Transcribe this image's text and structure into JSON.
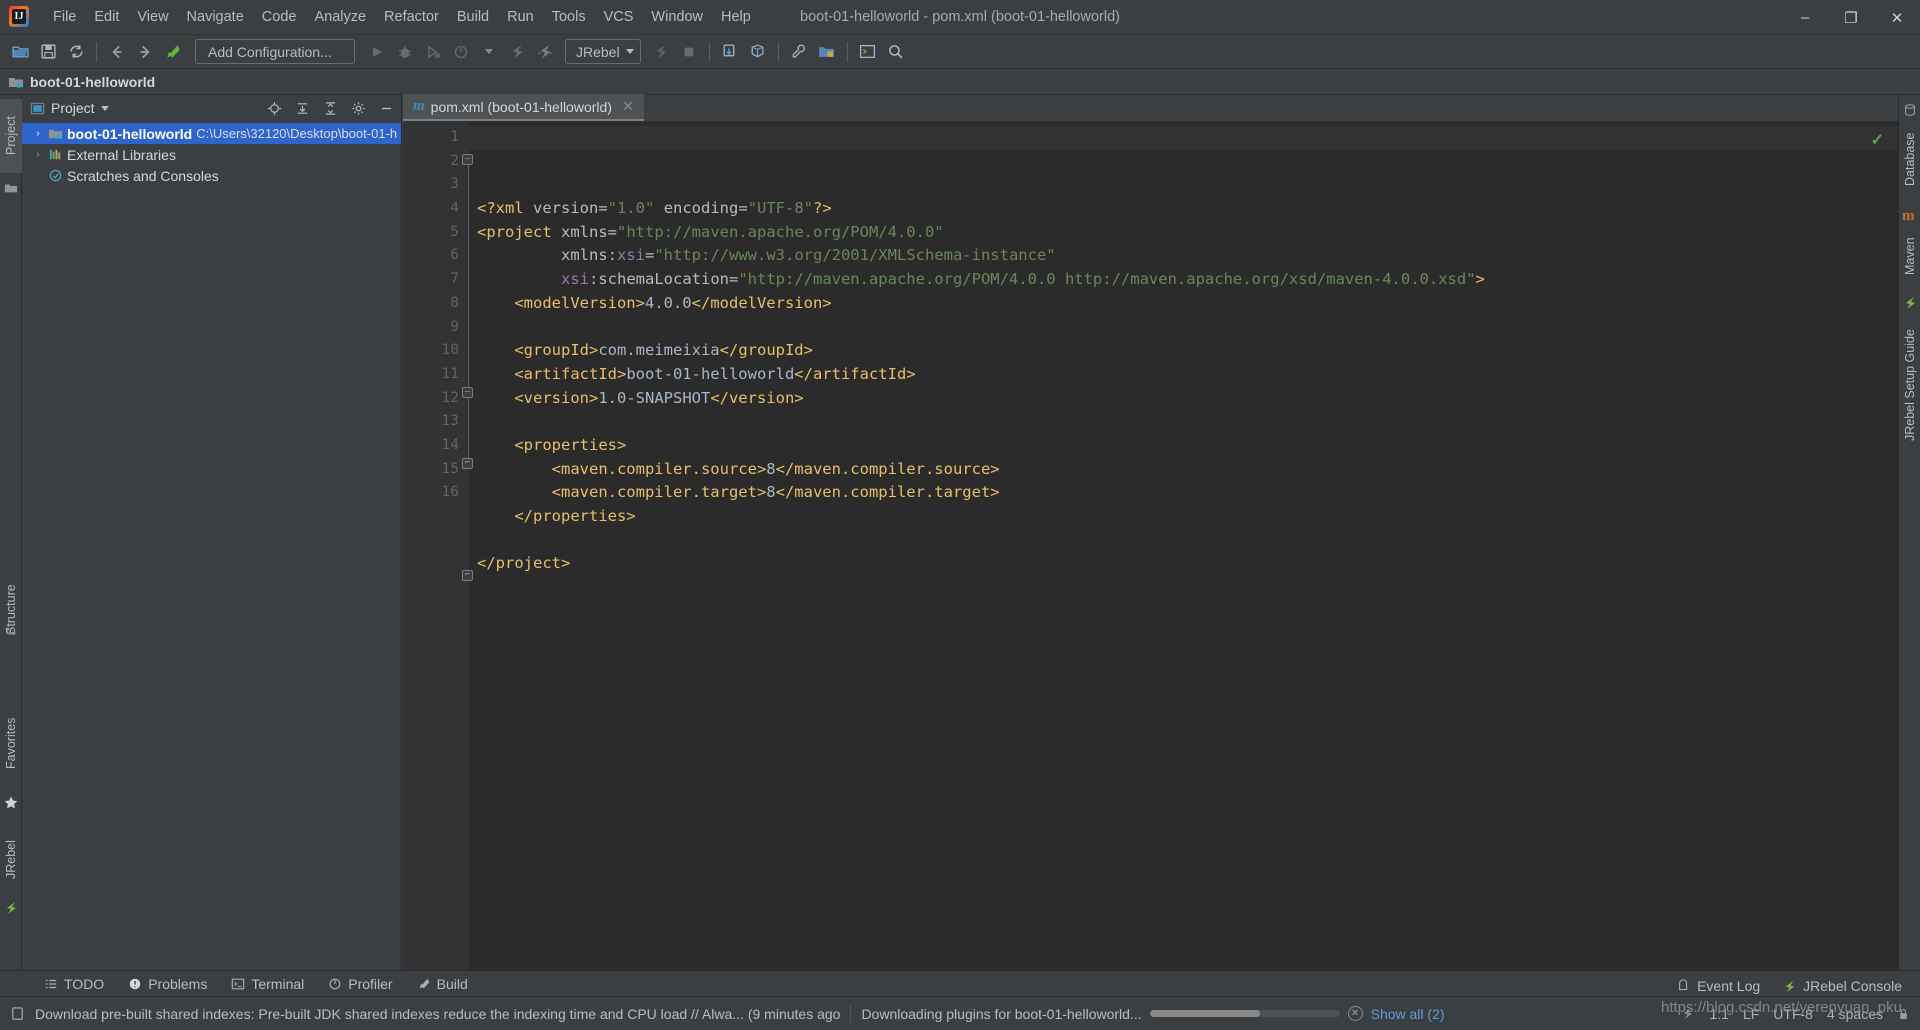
{
  "window": {
    "title": "boot-01-helloworld - pom.xml (boot-01-helloworld)",
    "minimize": "–",
    "maximize": "❐",
    "close": "✕"
  },
  "menubar": {
    "items": [
      {
        "label": "File"
      },
      {
        "label": "Edit"
      },
      {
        "label": "View"
      },
      {
        "label": "Navigate"
      },
      {
        "label": "Code"
      },
      {
        "label": "Analyze"
      },
      {
        "label": "Refactor"
      },
      {
        "label": "Build"
      },
      {
        "label": "Run"
      },
      {
        "label": "Tools"
      },
      {
        "label": "VCS"
      },
      {
        "label": "Window"
      },
      {
        "label": "Help"
      }
    ]
  },
  "toolbar": {
    "add_configuration": "Add Configuration...",
    "jrebel_label": "JRebel",
    "icons": [
      "open-folder-icon",
      "save-icon",
      "sync-icon",
      "back-arrow-icon",
      "forward-arrow-icon",
      "build-hammer-icon",
      "run-icon",
      "debug-icon",
      "run-coverage-icon",
      "profile-icon",
      "jrebel-run-icon",
      "jrebel-debug-icon",
      "stop-icon",
      "stop-square-icon",
      "update-project-icon",
      "commit-icon",
      "settings-wrench-icon",
      "project-structure-icon",
      "terminal-icon",
      "search-everywhere-icon"
    ]
  },
  "breadcrumb": {
    "project_name": "boot-01-helloworld"
  },
  "left_rail": {
    "items": [
      {
        "label": "Project",
        "active": true
      },
      {
        "label": "Structure",
        "active": false
      },
      {
        "label": "Favorites",
        "active": false
      },
      {
        "label": "JRebel",
        "active": false
      }
    ]
  },
  "right_rail": {
    "items": [
      {
        "label": "Database"
      },
      {
        "label": "Maven"
      },
      {
        "label": "JRebel Setup Guide"
      }
    ]
  },
  "project_panel": {
    "title": "Project",
    "header_buttons": [
      "locate-target-icon",
      "expand-all-icon",
      "collapse-all-icon",
      "gear-icon",
      "hide-icon"
    ],
    "tree": [
      {
        "label": "boot-01-helloworld",
        "path": "C:\\Users\\32120\\Desktop\\boot-01-h",
        "icon": "module-folder-icon",
        "arrow": "›",
        "selected": true,
        "bold": true,
        "indent": 0
      },
      {
        "label": "External Libraries",
        "path": "",
        "icon": "libraries-icon",
        "arrow": "›",
        "selected": false,
        "bold": false,
        "indent": 0
      },
      {
        "label": "Scratches and Consoles",
        "path": "",
        "icon": "scratches-icon",
        "arrow": "",
        "selected": false,
        "bold": false,
        "indent": 0
      }
    ]
  },
  "editor": {
    "tab": {
      "icon": "maven-m-icon",
      "label": "pom.xml (boot-01-helloworld)",
      "close": "✕"
    },
    "inspection_status": "✓",
    "line_numbers": [
      1,
      2,
      3,
      4,
      5,
      6,
      7,
      8,
      9,
      10,
      11,
      12,
      13,
      14,
      15,
      16
    ],
    "lines": [
      {
        "n": 1,
        "tokens": [
          {
            "t": "<?xml ",
            "c": "tag"
          },
          {
            "t": "version",
            "c": "attr"
          },
          {
            "t": "=",
            "c": "eq"
          },
          {
            "t": "\"1.0\"",
            "c": "str"
          },
          {
            "t": " ",
            "c": "txt"
          },
          {
            "t": "encoding",
            "c": "attr"
          },
          {
            "t": "=",
            "c": "eq"
          },
          {
            "t": "\"UTF-8\"",
            "c": "str"
          },
          {
            "t": "?>",
            "c": "tag"
          }
        ]
      },
      {
        "n": 2,
        "tokens": [
          {
            "t": "<project ",
            "c": "tag"
          },
          {
            "t": "xmlns",
            "c": "attr"
          },
          {
            "t": "=",
            "c": "eq"
          },
          {
            "t": "\"http://maven.apache.org/POM/4.0.0\"",
            "c": "str"
          }
        ]
      },
      {
        "n": 3,
        "tokens": [
          {
            "t": "         ",
            "c": "txt"
          },
          {
            "t": "xmlns:",
            "c": "attr"
          },
          {
            "t": "xsi",
            "c": "ns"
          },
          {
            "t": "=",
            "c": "eq"
          },
          {
            "t": "\"http://www.w3.org/2001/XMLSchema-instance\"",
            "c": "str"
          }
        ]
      },
      {
        "n": 4,
        "tokens": [
          {
            "t": "         ",
            "c": "txt"
          },
          {
            "t": "xsi",
            "c": "ns"
          },
          {
            "t": ":schemaLocation",
            "c": "attr"
          },
          {
            "t": "=",
            "c": "eq"
          },
          {
            "t": "\"http://maven.apache.org/POM/4.0.0 http://maven.apache.org/xsd/maven-4.0.0.xsd\"",
            "c": "str"
          },
          {
            "t": ">",
            "c": "tag"
          }
        ]
      },
      {
        "n": 5,
        "tokens": [
          {
            "t": "    ",
            "c": "txt"
          },
          {
            "t": "<modelVersion>",
            "c": "tag"
          },
          {
            "t": "4.0.0",
            "c": "txt"
          },
          {
            "t": "</modelVersion>",
            "c": "tag"
          }
        ]
      },
      {
        "n": 6,
        "tokens": []
      },
      {
        "n": 7,
        "tokens": [
          {
            "t": "    ",
            "c": "txt"
          },
          {
            "t": "<groupId>",
            "c": "tag"
          },
          {
            "t": "com.meimeixia",
            "c": "txt"
          },
          {
            "t": "</groupId>",
            "c": "tag"
          }
        ]
      },
      {
        "n": 8,
        "tokens": [
          {
            "t": "    ",
            "c": "txt"
          },
          {
            "t": "<artifactId>",
            "c": "tag"
          },
          {
            "t": "boot-01-helloworld",
            "c": "txt"
          },
          {
            "t": "</artifactId>",
            "c": "tag"
          }
        ]
      },
      {
        "n": 9,
        "tokens": [
          {
            "t": "    ",
            "c": "txt"
          },
          {
            "t": "<version>",
            "c": "tag"
          },
          {
            "t": "1.0-SNAPSHOT",
            "c": "txt"
          },
          {
            "t": "</version>",
            "c": "tag"
          }
        ]
      },
      {
        "n": 10,
        "tokens": []
      },
      {
        "n": 11,
        "tokens": [
          {
            "t": "    ",
            "c": "txt"
          },
          {
            "t": "<properties>",
            "c": "tag"
          }
        ]
      },
      {
        "n": 12,
        "tokens": [
          {
            "t": "        ",
            "c": "txt"
          },
          {
            "t": "<maven.compiler.source>",
            "c": "tag"
          },
          {
            "t": "8",
            "c": "txt"
          },
          {
            "t": "</maven.compiler.source>",
            "c": "tag"
          }
        ]
      },
      {
        "n": 13,
        "tokens": [
          {
            "t": "        ",
            "c": "txt"
          },
          {
            "t": "<maven.compiler.target>",
            "c": "tag"
          },
          {
            "t": "8",
            "c": "txt"
          },
          {
            "t": "</maven.compiler.target>",
            "c": "tag"
          }
        ]
      },
      {
        "n": 14,
        "tokens": [
          {
            "t": "    ",
            "c": "txt"
          },
          {
            "t": "</properties>",
            "c": "tag"
          }
        ]
      },
      {
        "n": 15,
        "tokens": []
      },
      {
        "n": 16,
        "tokens": [
          {
            "t": "</project>",
            "c": "tag"
          }
        ]
      }
    ]
  },
  "bottom_bar": {
    "items": [
      {
        "label": "TODO",
        "icon": "todo-icon"
      },
      {
        "label": "Problems",
        "icon": "problems-icon"
      },
      {
        "label": "Terminal",
        "icon": "terminal-icon"
      },
      {
        "label": "Profiler",
        "icon": "profiler-icon"
      },
      {
        "label": "Build",
        "icon": "build-hammer-icon"
      }
    ]
  },
  "statusbar": {
    "message": "Download pre-built shared indexes: Pre-built JDK shared indexes reduce the indexing time and CPU load // Alwa... (9 minutes ago",
    "progress_label": "Downloading plugins for boot-01-helloworld...",
    "show_all": "Show all (2)",
    "cancel": "✕",
    "caret_position": "1:1",
    "line_separator": "LF",
    "encoding": "UTF-8",
    "indent": "4 spaces",
    "event_log": "Event Log",
    "jrebel_console": "JRebel Console",
    "watermark": "https://blog.csdn.net/yerenyuan_pku"
  },
  "colors": {
    "accent_blue": "#2f65ca",
    "panel_bg": "#3c3f41",
    "editor_bg": "#2b2b2b",
    "gutter_bg": "#313335",
    "tag": "#e8bf6a",
    "string": "#6a8759",
    "ns": "#9876aa",
    "text": "#a9b7c6",
    "link": "#5f9bdc"
  }
}
